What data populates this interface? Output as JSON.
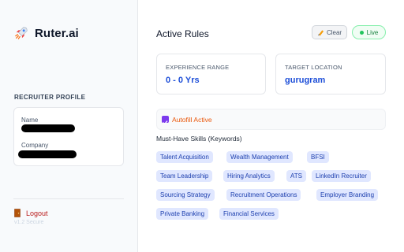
{
  "sidebar": {
    "brand": {
      "name": "Ruter.ai",
      "icon": "rocket-icon"
    },
    "profile_section_label": "RECRUITER PROFILE",
    "profile": {
      "name_label": "Name",
      "company_label": "Company"
    },
    "logout": {
      "label": "Logout",
      "icon": "door-icon"
    },
    "version": "v1.2 Secure"
  },
  "main": {
    "title": "Active Rules",
    "clear_button": {
      "label": "Clear",
      "icon": "eraser-icon"
    },
    "status_badge": {
      "label": "Live",
      "color": "#22c55e"
    },
    "experience": {
      "label": "EXPERIENCE RANGE",
      "value": "0 - 0 Yrs"
    },
    "location": {
      "label": "TARGET LOCATION",
      "value": "gurugram"
    },
    "autofill": {
      "label": "Autofill Active",
      "checked": true
    },
    "skills_heading": "Must-Have Skills (Keywords)",
    "skills": [
      "Talent Acquisition",
      "Wealth Management",
      "BFSI",
      "Team Leadership",
      "Hiring Analytics",
      "ATS",
      "LinkedIn Recruiter",
      "Sourcing Strategy",
      "Recruitment Operations",
      "Employer Branding",
      "Private Banking",
      "Financial Services"
    ]
  },
  "colors": {
    "accent_blue": "#1d4ed8",
    "chip_bg": "#e0e7ff",
    "logout_red": "#b91c1c",
    "autofill_orange": "#ea580c",
    "checkbox_purple": "#7c3aed"
  }
}
